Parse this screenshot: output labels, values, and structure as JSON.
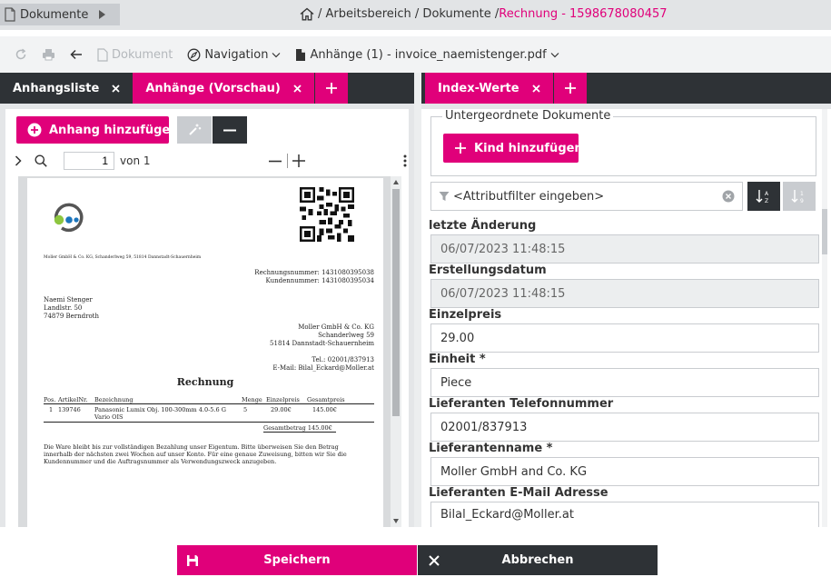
{
  "topbar": {
    "doc_toggle_label": "Dokumente",
    "breadcrumb_path": "/ Arbeitsbereich / Dokumente / ",
    "breadcrumb_current": "Rechnung - 1598678080457"
  },
  "toolbar": {
    "document_label": "Dokument",
    "navigation_label": "Navigation",
    "attachments_label": "Anhänge (1) - invoice_naemistenger.pdf"
  },
  "left": {
    "tabs": [
      {
        "label": "Anhangsliste",
        "active": false
      },
      {
        "label": "Anhänge (Vorschau)",
        "active": true
      }
    ],
    "add_attachment_label": "Anhang hinzufügen",
    "viewer": {
      "page_value": "1",
      "page_total": "von 1"
    },
    "invoice": {
      "sender_line": "Moller GmbH & Co. KG, Schanderlweg 59, 51814 Dannstadt-Schauernheim",
      "invoice_no": "Rechnungsnummer: 1431080395038",
      "customer_no": "Kundennummer: 1431080395034",
      "recipient": [
        "Naemi Stenger",
        "Landlstr. 50",
        "74879 Berndroth"
      ],
      "company": [
        "Moller GmbH & Co. KG",
        "Schanderlweg 59",
        "51814 Dannstadt-Schauernheim"
      ],
      "contact": [
        "Tel.: 02001/837913",
        "E-Mail: Bilal_Eckard@Moller.at"
      ],
      "title": "Rechnung",
      "headers": {
        "pos": "Pos.",
        "art": "ArtikelNr.",
        "desc": "Bezeichnung",
        "qty": "Menge",
        "unit": "Einzelpreis",
        "total": "Gesamtpreis"
      },
      "row": {
        "pos": "1",
        "art": "139746",
        "desc1": "Panasonic Lumix Obj. 100-300mm 4.0-5.6 G",
        "desc2": "Vario OIS",
        "qty": "5",
        "unit": "29.00€",
        "total": "145.00€"
      },
      "sum": "Gesamtbetrag 145.00€",
      "footer": [
        "Die Ware bleibt bis zur vollständigen Bezahlung unser Eigentum. Bitte überweisen Sie den Betrag",
        "innerhalb der nächsten zwei Wochen auf unser Konto. Für eine genaue Zuweisung, bitten wir Sie die",
        "Kundennummer und die Auftragsnummer als Verwendungszweck anzugeben."
      ]
    }
  },
  "right": {
    "tabs": [
      {
        "label": "Index-Werte",
        "active": true
      }
    ],
    "child_docs_legend": "Untergeordnete Dokumente",
    "add_child_label": "Kind hinzufügen",
    "filter_placeholder": "<Attributfilter eingeben>",
    "fields": [
      {
        "label": "letzte Änderung",
        "value": "06/07/2023 11:48:15",
        "readonly": true
      },
      {
        "label": "Erstellungsdatum",
        "value": "06/07/2023 11:48:15",
        "readonly": true
      },
      {
        "label": "Einzelpreis",
        "value": "29.00",
        "readonly": false
      },
      {
        "label": "Einheit *",
        "value": "Piece",
        "readonly": false
      },
      {
        "label": "Lieferanten Telefonnummer",
        "value": "02001/837913",
        "readonly": false
      },
      {
        "label": "Lieferantenname *",
        "value": "Moller GmbH and Co. KG",
        "readonly": false
      },
      {
        "label": "Lieferanten E-Mail Adresse",
        "value": "Bilal_Eckard@Moller.at",
        "readonly": false
      }
    ]
  },
  "bottom": {
    "save_label": "Speichern",
    "cancel_label": "Abbrechen"
  },
  "colors": {
    "accent": "#e0007a",
    "dark": "#2e3236"
  }
}
